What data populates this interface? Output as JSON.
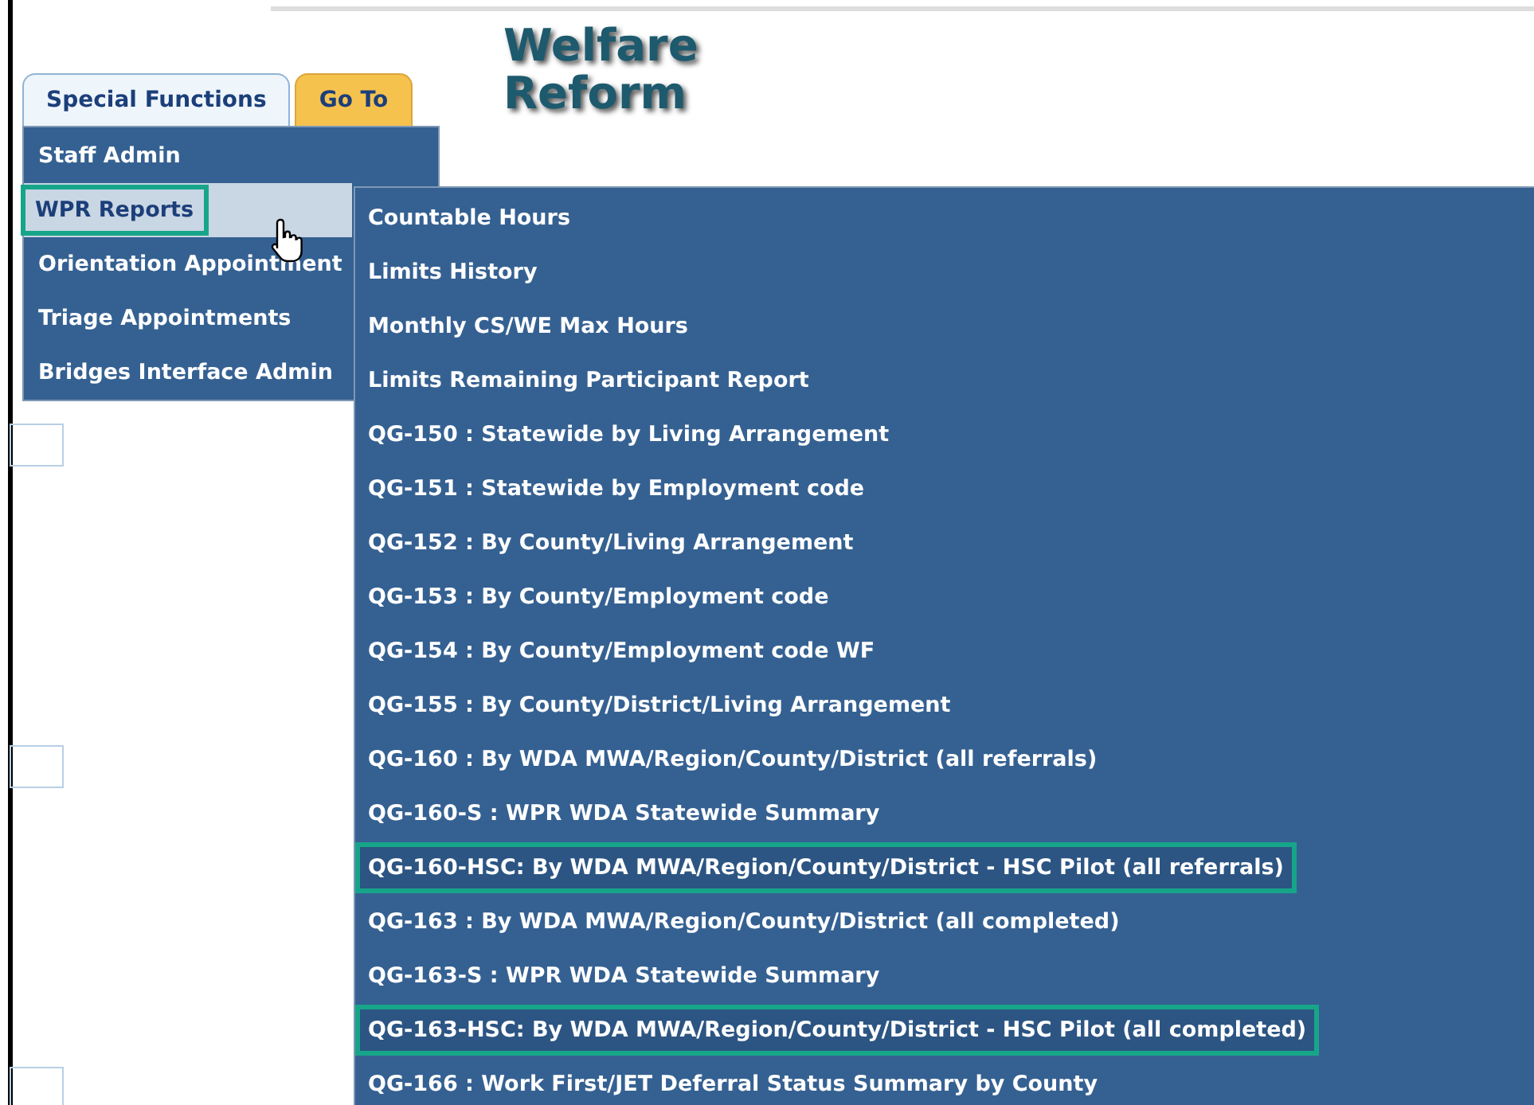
{
  "logo": {
    "line_1": "Welfare",
    "line_2": "Reform"
  },
  "tabs": [
    {
      "label": "Special Functions",
      "selected": true
    },
    {
      "label": "Go To",
      "selected": false
    }
  ],
  "menu": [
    {
      "label": "Staff Admin",
      "selected": false,
      "outlined": false
    },
    {
      "label": "WPR Reports",
      "selected": true,
      "outlined": true
    },
    {
      "label": "Orientation Appointment",
      "selected": false,
      "outlined": false
    },
    {
      "label": "Triage Appointments",
      "selected": false,
      "outlined": false
    },
    {
      "label": "Bridges Interface Admin",
      "selected": false,
      "outlined": false
    }
  ],
  "submenu": [
    {
      "label": "Countable Hours",
      "outlined": false
    },
    {
      "label": "Limits History",
      "outlined": false
    },
    {
      "label": "Monthly CS/WE Max Hours",
      "outlined": false
    },
    {
      "label": "Limits Remaining Participant Report",
      "outlined": false
    },
    {
      "label": "QG-150 : Statewide by Living Arrangement",
      "outlined": false
    },
    {
      "label": "QG-151 : Statewide by Employment code",
      "outlined": false
    },
    {
      "label": "QG-152 : By County/Living Arrangement",
      "outlined": false
    },
    {
      "label": "QG-153 : By County/Employment code",
      "outlined": false
    },
    {
      "label": "QG-154 : By County/Employment code WF",
      "outlined": false
    },
    {
      "label": "QG-155 : By County/District/Living Arrangement",
      "outlined": false
    },
    {
      "label": "QG-160 : By WDA MWA/Region/County/District (all referrals)",
      "outlined": false
    },
    {
      "label": "QG-160-S : WPR WDA Statewide Summary",
      "outlined": false
    },
    {
      "label": "QG-160-HSC: By WDA MWA/Region/County/District - HSC Pilot (all referrals)",
      "outlined": true
    },
    {
      "label": "QG-163 : By WDA MWA/Region/County/District (all completed)",
      "outlined": false
    },
    {
      "label": "QG-163-S : WPR WDA Statewide Summary",
      "outlined": false
    },
    {
      "label": "QG-163-HSC: By WDA MWA/Region/County/District - HSC Pilot (all completed)",
      "outlined": true
    },
    {
      "label": "QG-166 : Work First/JET Deferral Status Summary by County",
      "outlined": false
    }
  ]
}
